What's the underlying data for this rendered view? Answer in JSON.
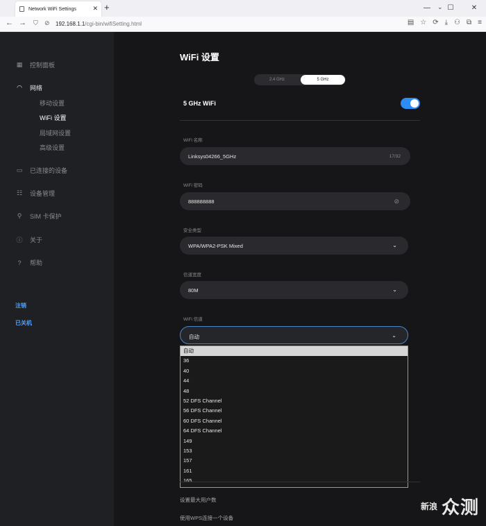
{
  "browser": {
    "tab_title": "Network WiFi Settings",
    "url_host": "192.168.1.1",
    "url_path": "/cgi-bin/wifiSetting.html"
  },
  "sidebar": {
    "items": [
      {
        "label": "控制面板",
        "icon": "dashboard-icon"
      },
      {
        "label": "网络",
        "icon": "wifi-icon"
      },
      {
        "label": "已连接的设备",
        "icon": "devices-icon"
      },
      {
        "label": "设备管理",
        "icon": "settings-sliders-icon"
      },
      {
        "label": "SIM 卡保护",
        "icon": "lock-icon"
      },
      {
        "label": "关于",
        "icon": "info-icon"
      },
      {
        "label": "帮助",
        "icon": "help-icon"
      }
    ],
    "sub_items": [
      "移动设置",
      "WiFi 设置",
      "局域网设置",
      "高级设置"
    ],
    "logout": "注销",
    "shutdown": "已关机"
  },
  "main": {
    "title": "WiFi 设置",
    "bands": [
      "2.4 GHz",
      "5 GHz"
    ],
    "selected_band": "5 GHz",
    "section_title": "5 GHz WiFi",
    "wifi_enabled": true,
    "ssid_label": "WiFi 名称",
    "ssid_value": "Linksys04266_5GHz",
    "ssid_count": "17/32",
    "password_label": "WiFi 密码",
    "password_value": "888888888",
    "security_label": "安全类型",
    "security_value": "WPA/WPA2-PSK Mixed",
    "bandwidth_label": "信道宽度",
    "bandwidth_value": "80M",
    "channel_label": "WiFi 信道",
    "channel_value": "自动",
    "channel_options": [
      "自动",
      "36",
      "40",
      "44",
      "48",
      "52 DFS Channel",
      "56 DFS Channel",
      "60 DFS Channel",
      "64 DFS Channel",
      "149",
      "153",
      "157",
      "161",
      "165"
    ],
    "max_users_label": "设置最大用户数",
    "wps_label": "使用WPS连接一个设备"
  },
  "watermark": {
    "a": "新浪",
    "b": "众测"
  },
  "colors": {
    "accent": "#2e8df2",
    "link": "#4ea3ff",
    "background": "#161618",
    "sidebar": "#1f2023"
  }
}
